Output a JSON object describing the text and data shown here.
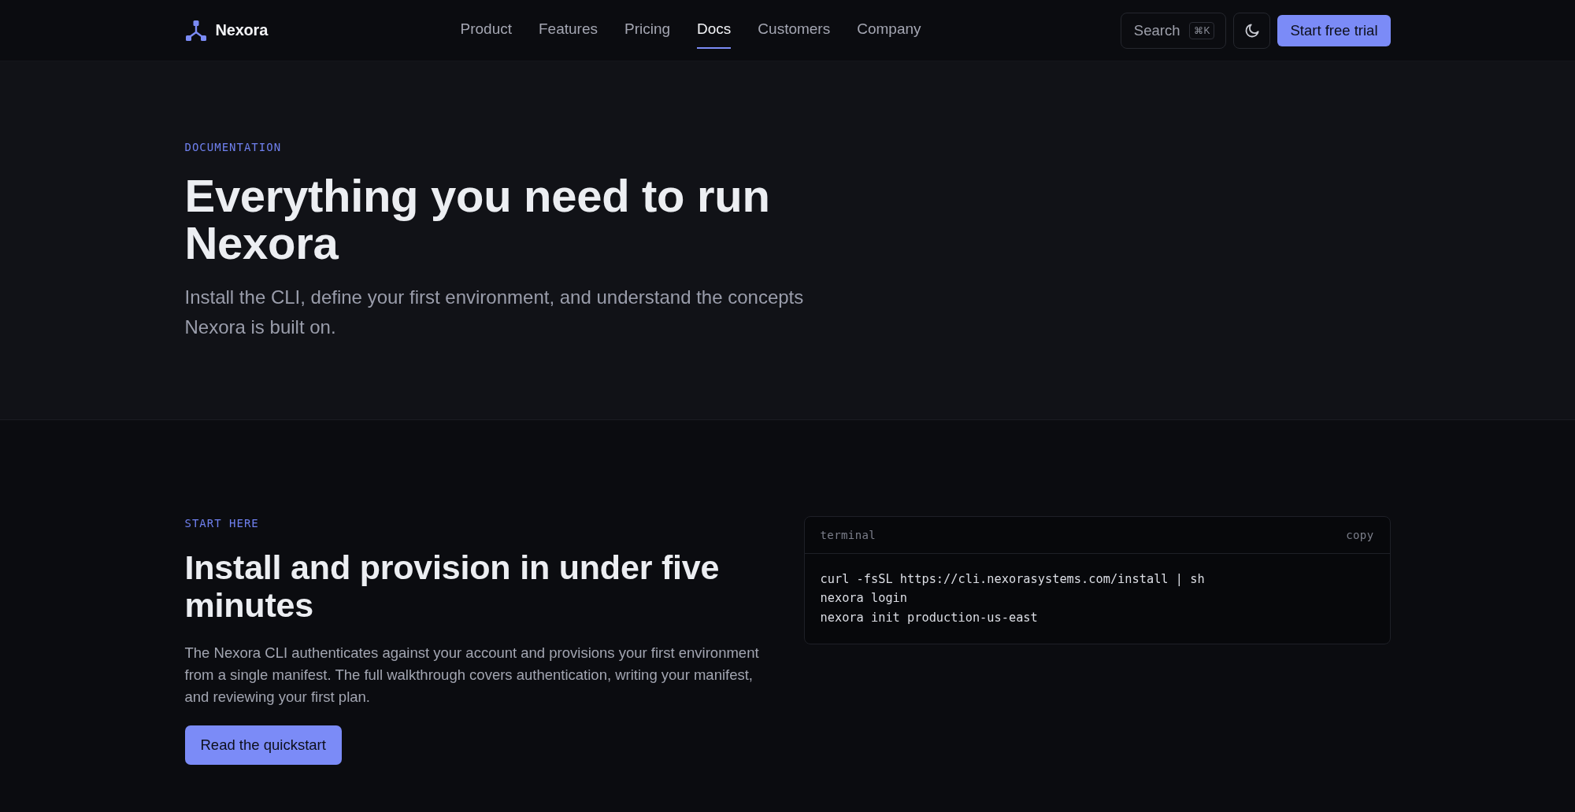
{
  "nav": {
    "brand": "Nexora",
    "links": [
      {
        "label": "Product",
        "selected": false
      },
      {
        "label": "Features",
        "selected": false
      },
      {
        "label": "Pricing",
        "selected": false
      },
      {
        "label": "Docs",
        "selected": true
      },
      {
        "label": "Customers",
        "selected": false
      },
      {
        "label": "Company",
        "selected": false
      }
    ],
    "search": {
      "label": "Search",
      "shortcut": "⌘K"
    },
    "cta": "Start free trial"
  },
  "hero": {
    "eyebrow": "DOCUMENTATION",
    "title": "Everything you need to run Nexora",
    "subtitle": "Install the CLI, define your first environment, and understand the concepts Nexora is built on."
  },
  "start": {
    "eyebrow": "START HERE",
    "title": "Install and provision in under five minutes",
    "description": "The Nexora CLI authenticates against your account and provisions your first environment from a single manifest. The full walkthrough covers authentication, writing your manifest, and reviewing your first plan.",
    "button": "Read the quickstart",
    "terminal": {
      "label": "terminal",
      "copy": "copy",
      "lines": [
        "curl -fsSL https://cli.nexorasystems.com/install | sh",
        "nexora login",
        "nexora init production-us-east"
      ]
    }
  }
}
